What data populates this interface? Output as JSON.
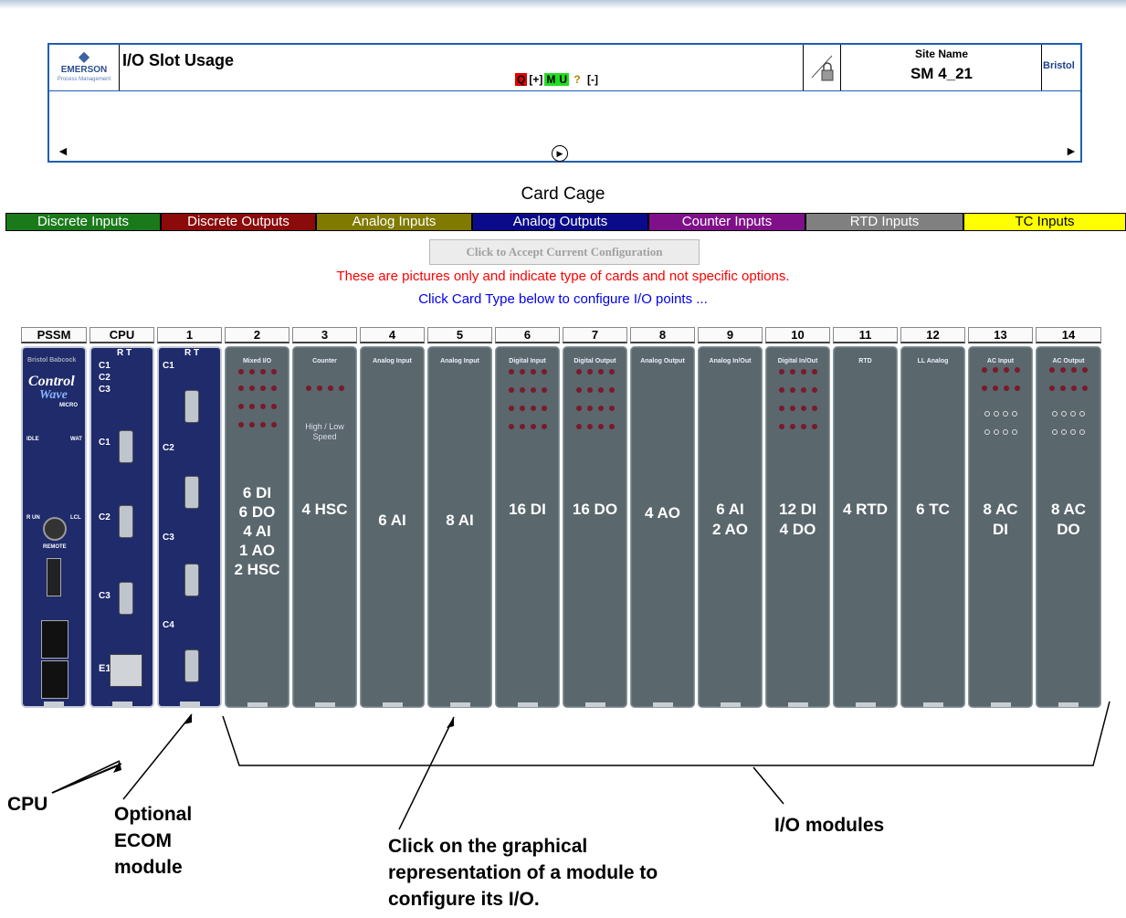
{
  "header": {
    "logo_brand": "EMERSON",
    "logo_sub": "Process Management",
    "title": "I/O Slot Usage",
    "tools": [
      "Q",
      "[+]",
      "M",
      "U",
      "?",
      "[-]"
    ],
    "site_label": "Site Name",
    "site_value": "SM 4_21",
    "brand_right": "Bristol",
    "nav_left": "◄",
    "nav_center": "▶",
    "nav_right": "►"
  },
  "cage": {
    "title": "Card Cage",
    "legend": [
      {
        "label": "Discrete Inputs",
        "color": "#1a7a1a"
      },
      {
        "label": "Discrete Outputs",
        "color": "#8b0a0a"
      },
      {
        "label": "Analog Inputs",
        "color": "#807a00"
      },
      {
        "label": "Analog Outputs",
        "color": "#0a0a8a"
      },
      {
        "label": "Counter Inputs",
        "color": "#80108a"
      },
      {
        "label": "RTD Inputs",
        "color": "#808080"
      },
      {
        "label": "TC Inputs",
        "color": "#ffff00"
      }
    ],
    "accept_button": "Click to Accept Current Configuration",
    "note_red": "These are pictures only and indicate type of cards and not specific options.",
    "note_blue": "Click Card Type below to configure I/O points ..."
  },
  "slots": [
    "PSSM",
    "CPU",
    "1",
    "2",
    "3",
    "4",
    "5",
    "6",
    "7",
    "8",
    "9",
    "10",
    "11",
    "12",
    "13",
    "14"
  ],
  "cards": [
    {
      "title": "Mixed I/O",
      "label": [
        "6 DI",
        "6 DO",
        "4 AI",
        "1 AO",
        "2 HSC"
      ]
    },
    {
      "title": "Counter",
      "label": [
        "4 HSC"
      ],
      "extra": "High / Low Speed"
    },
    {
      "title": "Analog Input",
      "label": [
        "6 AI"
      ]
    },
    {
      "title": "Analog Input",
      "label": [
        "8 AI"
      ]
    },
    {
      "title": "Digital Input",
      "label": [
        "16 DI"
      ]
    },
    {
      "title": "Digital Output",
      "label": [
        "16 DO"
      ]
    },
    {
      "title": "Analog Output",
      "label": [
        "4 AO"
      ]
    },
    {
      "title": "Analog In/Out",
      "label": [
        "6 AI",
        "2 AO"
      ]
    },
    {
      "title": "Digital In/Out",
      "label": [
        "12 DI",
        "4 DO"
      ]
    },
    {
      "title": "RTD",
      "label": [
        "4 RTD"
      ]
    },
    {
      "title": "LL Analog",
      "label": [
        "6 TC"
      ]
    },
    {
      "title": "AC Input",
      "label": [
        "8 AC",
        "DI"
      ]
    },
    {
      "title": "AC Output",
      "label": [
        "8 AC",
        "DO"
      ]
    }
  ],
  "pssm": {
    "brand": "Bristol Babcock",
    "logo1": "Control",
    "logo2": "Wave",
    "logo3": "MICRO",
    "idle": "IDLE",
    "watch": "WAT",
    "run": "R UN",
    "local": "LCL",
    "remote": "REMOTE"
  },
  "cpu_labels": {
    "rt": "R T",
    "c1": "C1",
    "c2": "C2",
    "c3": "C3",
    "e1": "E1"
  },
  "ecom_labels": {
    "rt": "R T",
    "c1": "C1",
    "c2": "C2",
    "c3": "C3",
    "c4": "C4"
  },
  "callouts": {
    "cpu": "CPU",
    "ecom": "Optional ECOM module",
    "click": "Click on the graphical representation of a module to configure its I/O.",
    "io": "I/O modules"
  }
}
